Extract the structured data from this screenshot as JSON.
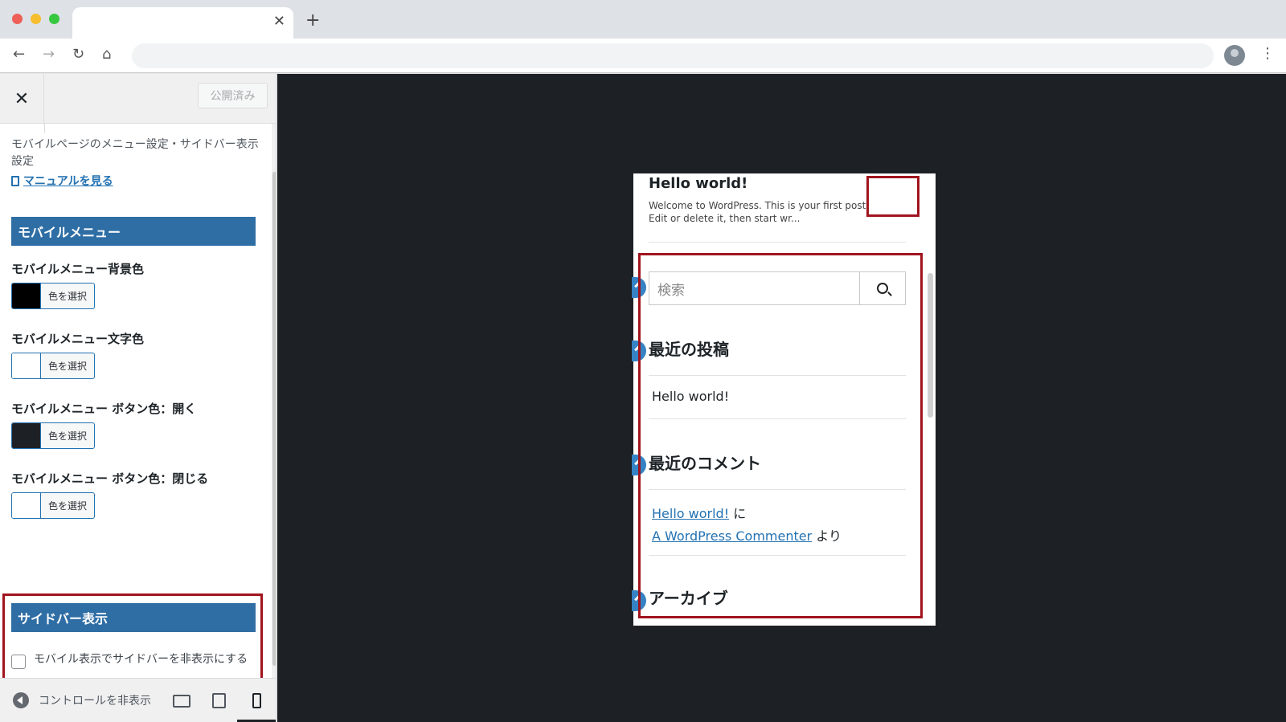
{
  "browser": {
    "tab_close": "✕",
    "new_tab": "+",
    "back": "←",
    "forward": "→",
    "reload": "↻",
    "home": "⌂",
    "menu": "⋮"
  },
  "customizer": {
    "close": "✕",
    "published_label": "公開済み",
    "description": "モバイルページのメニュー設定・サイドバー表示設定",
    "manual_link": "マニュアルを見る",
    "section_mobile_menu": "モバイルメニュー",
    "controls": [
      {
        "label": "モバイルメニュー背景色",
        "button": "色を選択",
        "color": "#000000"
      },
      {
        "label": "モバイルメニュー文字色",
        "button": "色を選択",
        "color": "#ffffff"
      },
      {
        "label": "モバイルメニュー ボタン色：開く",
        "button": "色を選択",
        "color": "#1d2125"
      },
      {
        "label": "モバイルメニュー ボタン色：閉じる",
        "button": "色を選択",
        "color": "#ffffff"
      }
    ],
    "section_sidebar": "サイドバー表示",
    "sidebar_checkbox_label": "モバイル表示でサイドバーを非表示にする",
    "sidebar_checkbox_checked": false,
    "hide_controls": "コントロールを非表示",
    "devices": [
      "desktop-icon",
      "tablet-icon",
      "mobile-icon"
    ],
    "active_device": "mobile"
  },
  "preview": {
    "post_title": "Hello world!",
    "post_excerpt": "Welcome to WordPress. This is your first post. Edit or delete it, then start wr...",
    "search_placeholder": "検索",
    "recent_posts_heading": "最近の投稿",
    "recent_post": "Hello world!",
    "recent_comments_heading": "最近のコメント",
    "comment_post_link": "Hello world!",
    "comment_on": "に",
    "comment_author_link": "A WordPress Commenter",
    "comment_by": "より",
    "archives_heading": "アーカイブ"
  },
  "colors": {
    "accent": "#2f6ea5",
    "highlight_red": "#a0141e",
    "link": "#2271b1",
    "preview_bg": "#1d2125"
  }
}
